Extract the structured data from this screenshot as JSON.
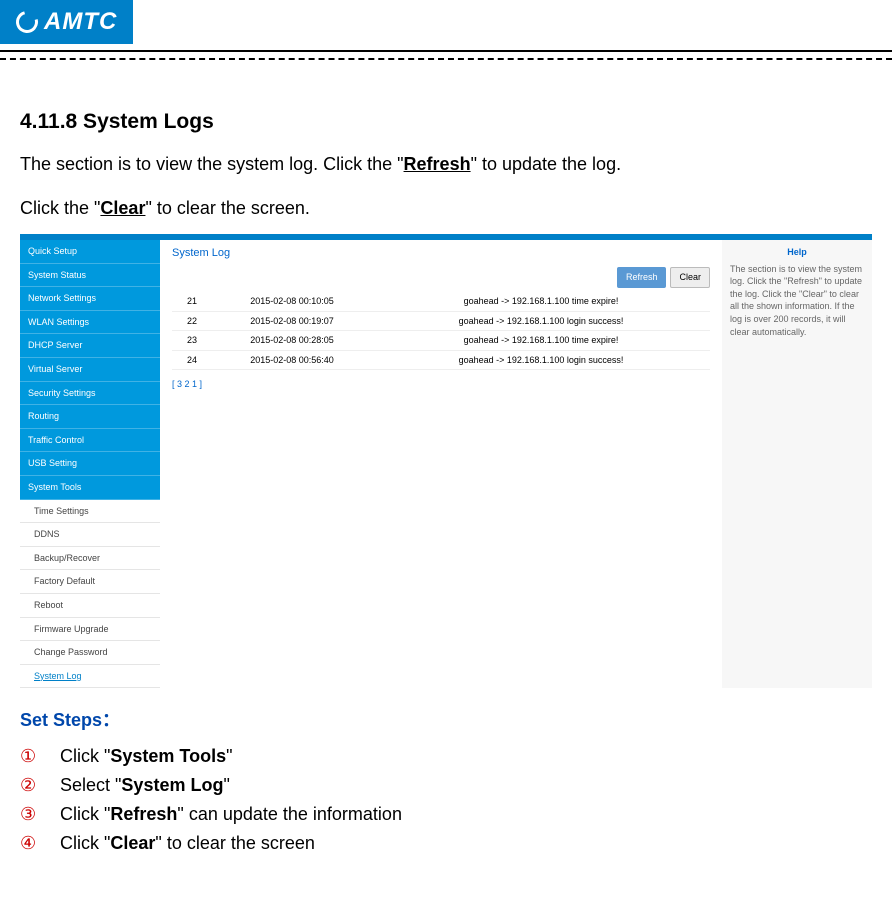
{
  "logo_text": "AMTC",
  "section_heading": "4.11.8 System Logs",
  "intro_prefix": "The section is to view the system log. Click the \"",
  "intro_bold1": "Refresh",
  "intro_suffix1": "\" to update the log.",
  "intro2_prefix": "Click the \"",
  "intro2_bold": "Clear",
  "intro2_suffix": "\" to clear the screen.",
  "ui": {
    "nav": [
      "Quick Setup",
      "System Status",
      "Network Settings",
      "WLAN Settings",
      "DHCP Server",
      "Virtual Server",
      "Security Settings",
      "Routing",
      "Traffic Control",
      "USB Setting",
      "System Tools"
    ],
    "sub_nav": [
      "Time Settings",
      "DDNS",
      "Backup/Recover",
      "Factory Default",
      "Reboot",
      "Firmware Upgrade",
      "Change Password",
      "System Log"
    ],
    "panel_title": "System Log",
    "refresh_label": "Refresh",
    "clear_label": "Clear",
    "log_rows": [
      {
        "n": "21",
        "t": "2015-02-08 00:10:05",
        "m": "goahead -> 192.168.1.100 time expire!"
      },
      {
        "n": "22",
        "t": "2015-02-08 00:19:07",
        "m": "goahead -> 192.168.1.100 login success!"
      },
      {
        "n": "23",
        "t": "2015-02-08 00:28:05",
        "m": "goahead -> 192.168.1.100 time expire!"
      },
      {
        "n": "24",
        "t": "2015-02-08 00:56:40",
        "m": "goahead -> 192.168.1.100 login success!"
      }
    ],
    "pager": "[ 3 2 1 ]",
    "help_title": "Help",
    "help_text": "The section is to view the system log. Click the \"Refresh\" to update the log. Click the \"Clear\" to clear all the shown information. If the log is over 200 records, it will clear automatically."
  },
  "steps_heading": "Set Steps：",
  "steps": [
    {
      "num": "①",
      "pre": "Click \"",
      "bold": "System Tools",
      "post": "\""
    },
    {
      "num": "②",
      "pre": "Select \"",
      "bold": "System Log",
      "post": "\""
    },
    {
      "num": "③",
      "pre": "Click \"",
      "bold": "Refresh",
      "post": "\" can update the information"
    },
    {
      "num": "④",
      "pre": "Click \"",
      "bold": "Clear",
      "post": "\" to clear the screen"
    }
  ]
}
